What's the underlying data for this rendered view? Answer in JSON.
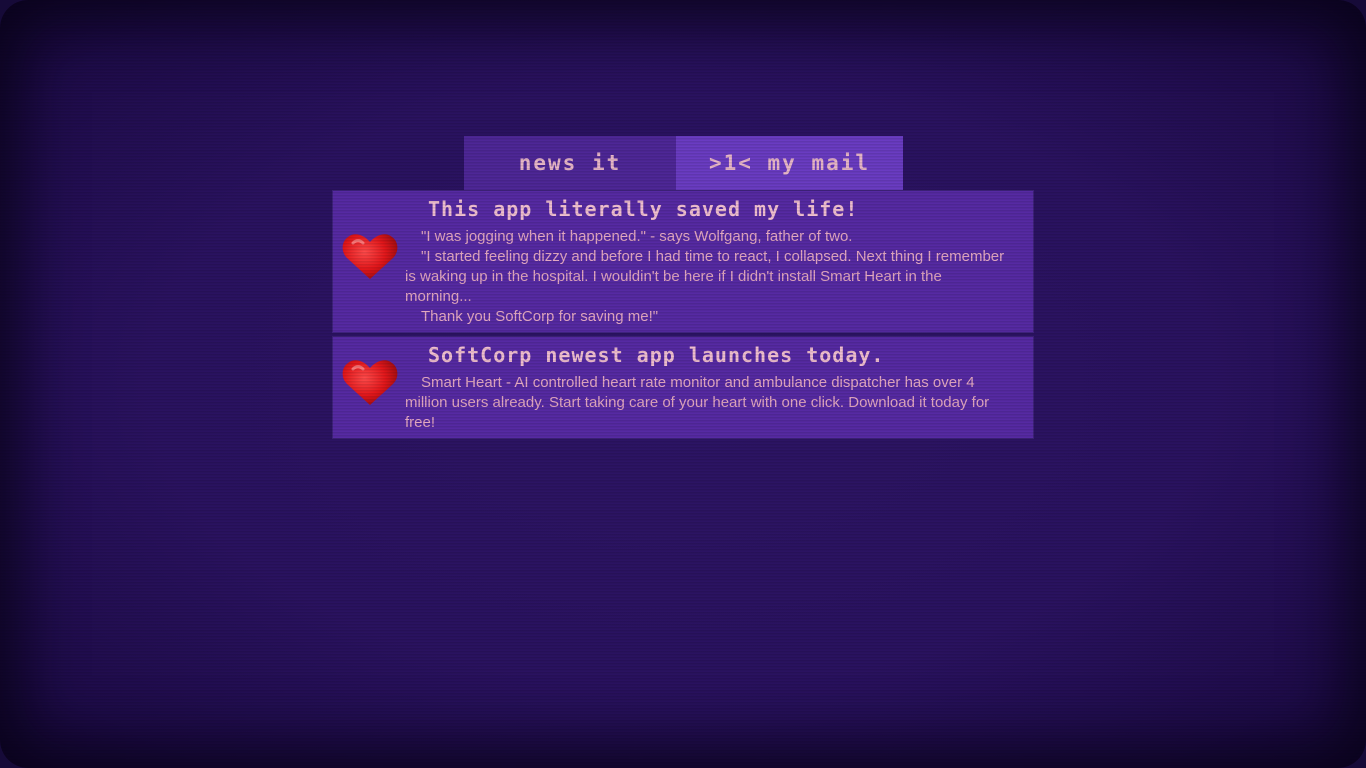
{
  "tabs": {
    "news": "news it",
    "mail": ">1< my mail"
  },
  "articles": [
    {
      "title": "This app literally saved my life!",
      "icon": "heart-icon",
      "paragraphs": [
        "\"I was jogging when it happened.\" - says Wolfgang, father of two.",
        "\"I started feeling dizzy and before I had time to react, I collapsed. Next thing I remember is waking up in the hospital. I wouldin't be here if I didn't install Smart Heart in the morning...",
        "Thank you SoftCorp for saving me!\""
      ]
    },
    {
      "title": "SoftCorp newest app launches today.",
      "icon": "heart-icon",
      "paragraphs": [
        "Smart Heart - AI controlled heart rate monitor and ambulance dispatcher has over 4 million users already. Start taking care of your heart with one click. Download it today for free!"
      ]
    }
  ],
  "colors": {
    "background": "#2a1260",
    "card": "#562aa3",
    "active_tab": "#6a3cc2",
    "inactive_tab": "#4e2797",
    "text": "#e3a8c2",
    "heart": "#e0181c"
  }
}
